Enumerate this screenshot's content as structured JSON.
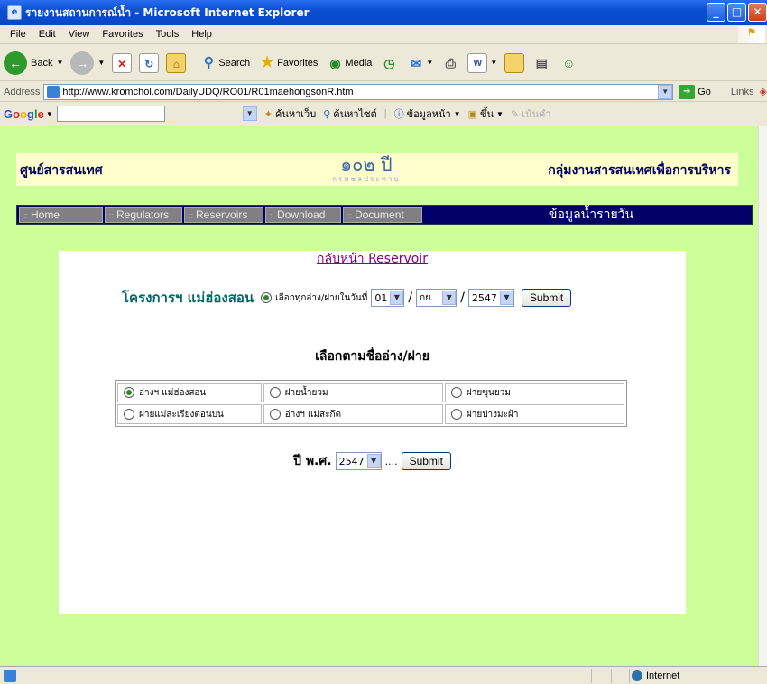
{
  "window": {
    "title": "รายงานสถานการณ์น้ำ - Microsoft Internet Explorer"
  },
  "menu": [
    "File",
    "Edit",
    "View",
    "Favorites",
    "Tools",
    "Help"
  ],
  "toolbar": {
    "back": "Back",
    "search": "Search",
    "favorites": "Favorites",
    "media": "Media"
  },
  "address": {
    "label": "Address",
    "url": "http://www.kromchol.com/DailyUDQ/RO01/R01maehongsonR.htm",
    "go": "Go",
    "links": "Links"
  },
  "google": {
    "logo": "Google",
    "search_web": "ค้นหาเว็บ",
    "search_site": "ค้นหาไซต์",
    "page_info": "ข้อมูลหน้า",
    "up": "ขึ้น",
    "highlight": "เน้นคำ"
  },
  "banner": {
    "left": "ศูนย์สารสนเทศ",
    "logo_big": "๑๐๒ ปี",
    "logo_small": "กรมชลประทาน",
    "right": "กลุ่มงานสารสนเทศเพื่อการบริหาร"
  },
  "nav": {
    "items": [
      "Home",
      "Regulators",
      "Reservoirs",
      "Download",
      "Document"
    ],
    "daily": "ข้อมูลน้ำรายวัน"
  },
  "panel": {
    "back_link": "กลับหน้า Reservoir",
    "project": "โครงการฯ แม่ฮ่องสอน",
    "select_all_label": "เลือกทุกอ่าง/ฝายในวันที่",
    "day": "01",
    "month": "กย.",
    "year": "2547",
    "submit": "Submit",
    "heading": "เลือกตามชื่ออ่าง/ฝาย",
    "options": [
      [
        "อ่างฯ แม่ฮ่องสอน",
        "ฝายน้ำยวม",
        "ฝายขุนยวม"
      ],
      [
        "ฝายแม่สะเรียงตอนบน",
        "อ่างฯ แม่สะกึด",
        "ฝายปางมะผ้า"
      ]
    ],
    "year_label": "ปี พ.ศ.",
    "year_value": "2547",
    "ellipsis": "....",
    "submit2": "Submit"
  },
  "status": {
    "zone": "Internet"
  }
}
